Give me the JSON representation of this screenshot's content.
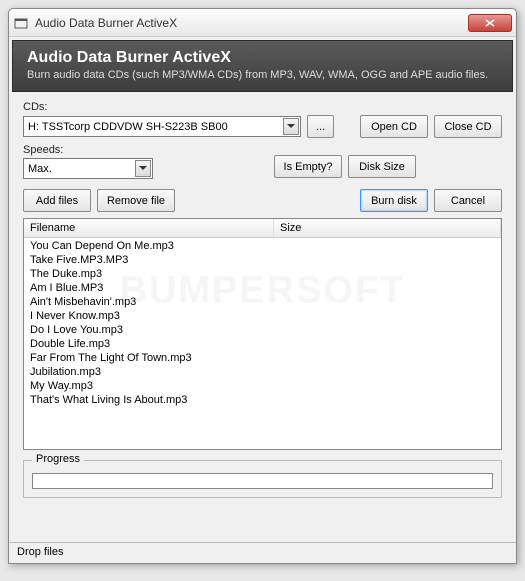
{
  "window": {
    "title": "Audio Data Burner ActiveX"
  },
  "header": {
    "title": "Audio Data Burner ActiveX",
    "subtitle": "Burn audio data CDs (such MP3/WMA CDs) from MP3, WAV, WMA, OGG and APE audio files."
  },
  "labels": {
    "cds": "CDs:",
    "speeds": "Speeds:"
  },
  "combos": {
    "drive": "H: TSSTcorp CDDVDW SH-S223B  SB00",
    "speed": "Max."
  },
  "buttons": {
    "browse": "...",
    "open_cd": "Open CD",
    "close_cd": "Close CD",
    "is_empty": "Is Empty?",
    "disk_size": "Disk Size",
    "add_files": "Add files",
    "remove_file": "Remove file",
    "burn_disk": "Burn disk",
    "cancel": "Cancel"
  },
  "listview": {
    "columns": {
      "filename": "Filename",
      "size": "Size"
    },
    "items": [
      "You Can Depend On Me.mp3",
      "Take Five.MP3.MP3",
      "The Duke.mp3",
      "Am I Blue.MP3",
      "Ain't Misbehavin'.mp3",
      "I Never Know.mp3",
      "Do I Love You.mp3",
      "Double Life.mp3",
      "Far From The Light Of Town.mp3",
      "Jubilation.mp3",
      "My Way.mp3",
      "That's What Living Is About.mp3"
    ]
  },
  "progress": {
    "label": "Progress"
  },
  "statusbar": {
    "text": "Drop files"
  },
  "watermark": "BUMPERSOFT"
}
